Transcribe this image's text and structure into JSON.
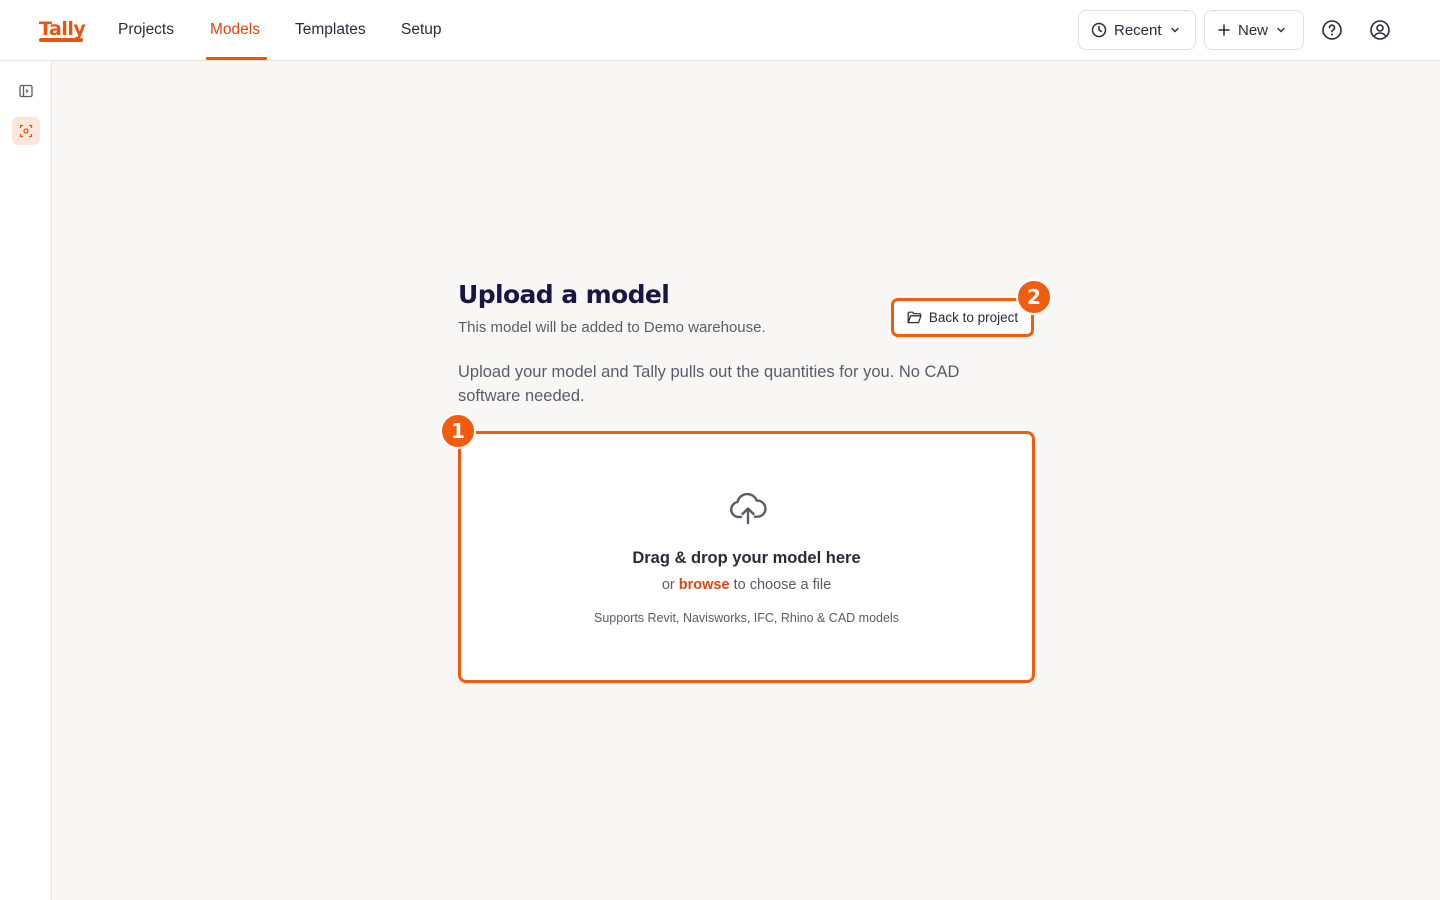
{
  "app": {
    "logo": "Tally"
  },
  "nav": {
    "items": [
      {
        "label": "Projects"
      },
      {
        "label": "Models",
        "active": true
      },
      {
        "label": "Templates"
      },
      {
        "label": "Setup"
      }
    ]
  },
  "header_actions": {
    "recent_label": "Recent",
    "new_label": "New"
  },
  "page": {
    "title": "Upload a model",
    "subtitle": "This model will be added to Demo warehouse.",
    "description": "Upload your model and Tally pulls out the quantities for you. No CAD software needed.",
    "back_button": "Back to project"
  },
  "dropzone": {
    "title": "Drag & drop your model here",
    "or": "or",
    "browse": "browse",
    "choose": "to choose a file",
    "note": "Supports Revit, Navisworks, IFC, Rhino & CAD models"
  },
  "annotations": {
    "badge_1": "1",
    "badge_2": "2"
  },
  "colors": {
    "accent": "#f25c0f",
    "brand": "#e8550f",
    "title": "#1b1545",
    "background": "#f9f7f5"
  }
}
